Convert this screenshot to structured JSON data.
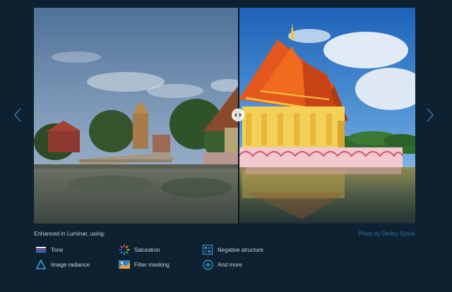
{
  "caption": "Enhanced in Luminar, using:",
  "credit": "Photo by Dmitry Sytnik",
  "tools": [
    {
      "label": "Tone",
      "icon": "tone-icon"
    },
    {
      "label": "Saturation",
      "icon": "saturation-icon"
    },
    {
      "label": "Negative structure",
      "icon": "negative-structure-icon"
    },
    {
      "label": "Image radiance",
      "icon": "image-radiance-icon"
    },
    {
      "label": "Filter masking",
      "icon": "filter-masking-icon"
    },
    {
      "label": "And more",
      "icon": "and-more-icon"
    }
  ],
  "comparison": {
    "before_image": "temple-before-photo",
    "after_image": "temple-after-photo",
    "split_position": 0.535
  },
  "colors": {
    "background": "#0d2131",
    "link": "#2e74a3",
    "accent": "#3aa3d8"
  }
}
